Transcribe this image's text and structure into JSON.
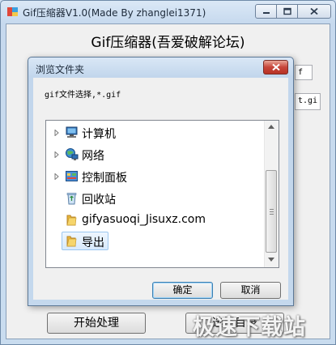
{
  "window": {
    "title": "Gif压缩器V1.0(Made By zhanglei1371)",
    "heading": "Gif压缩器(吾爱破解论坛)",
    "field_top_value": "f",
    "field_bottom_value": "t.gi",
    "start_button": "开始处理",
    "right_button": "选择目录"
  },
  "dialog": {
    "title": "浏览文件夹",
    "description": "gif文件选择,*.gif",
    "tree": [
      {
        "label": "计算机",
        "icon": "computer-icon",
        "expandable": true,
        "selected": false
      },
      {
        "label": "网络",
        "icon": "network-icon",
        "expandable": true,
        "selected": false
      },
      {
        "label": "控制面板",
        "icon": "control-panel-icon",
        "expandable": true,
        "selected": false
      },
      {
        "label": "回收站",
        "icon": "recycle-bin-icon",
        "expandable": false,
        "selected": false
      },
      {
        "label": "gifyasuoqi_Jisuxz.com",
        "icon": "folder-icon",
        "expandable": false,
        "selected": false
      },
      {
        "label": "导出",
        "icon": "folder-icon",
        "expandable": false,
        "selected": true
      }
    ],
    "ok_button": "确定",
    "cancel_button": "取消"
  },
  "watermark": "极速下载站",
  "colors": {
    "titlebar": "#c6d9ee",
    "selection": "#d8eafc",
    "close_red": "#c7453a",
    "folder_yellow": "#f2c94c"
  }
}
